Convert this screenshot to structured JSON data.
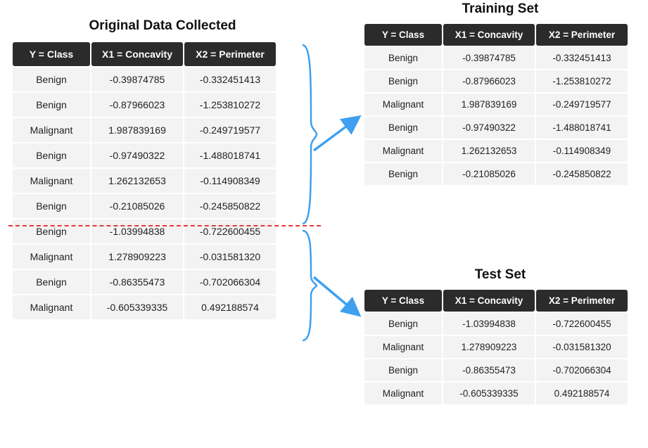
{
  "titles": {
    "original": "Original Data Collected",
    "training": "Training Set",
    "test": "Test Set"
  },
  "columns": {
    "y": "Y = Class",
    "x1": "X1 = Concavity",
    "x2": "X2 = Perimeter"
  },
  "original_rows": [
    {
      "y": "Benign",
      "x1": "-0.39874785",
      "x2": "-0.332451413"
    },
    {
      "y": "Benign",
      "x1": "-0.87966023",
      "x2": "-1.253810272"
    },
    {
      "y": "Malignant",
      "x1": "1.987839169",
      "x2": "-0.249719577"
    },
    {
      "y": "Benign",
      "x1": "-0.97490322",
      "x2": "-1.488018741"
    },
    {
      "y": "Malignant",
      "x1": "1.262132653",
      "x2": "-0.114908349"
    },
    {
      "y": "Benign",
      "x1": "-0.21085026",
      "x2": "-0.245850822"
    },
    {
      "y": "Benign",
      "x1": "-1.03994838",
      "x2": "-0.722600455"
    },
    {
      "y": "Malignant",
      "x1": "1.278909223",
      "x2": "-0.031581320"
    },
    {
      "y": "Benign",
      "x1": "-0.86355473",
      "x2": "-0.702066304"
    },
    {
      "y": "Malignant",
      "x1": "-0.605339335",
      "x2": "0.492188574"
    }
  ],
  "training_rows": [
    {
      "y": "Benign",
      "x1": "-0.39874785",
      "x2": "-0.332451413"
    },
    {
      "y": "Benign",
      "x1": "-0.87966023",
      "x2": "-1.253810272"
    },
    {
      "y": "Malignant",
      "x1": "1.987839169",
      "x2": "-0.249719577"
    },
    {
      "y": "Benign",
      "x1": "-0.97490322",
      "x2": "-1.488018741"
    },
    {
      "y": "Malignant",
      "x1": "1.262132653",
      "x2": "-0.114908349"
    },
    {
      "y": "Benign",
      "x1": "-0.21085026",
      "x2": "-0.245850822"
    }
  ],
  "test_rows": [
    {
      "y": "Benign",
      "x1": "-1.03994838",
      "x2": "-0.722600455"
    },
    {
      "y": "Malignant",
      "x1": "1.278909223",
      "x2": "-0.031581320"
    },
    {
      "y": "Benign",
      "x1": "-0.86355473",
      "x2": "-0.702066304"
    },
    {
      "y": "Malignant",
      "x1": "-0.605339335",
      "x2": "0.492188574"
    }
  ],
  "colors": {
    "arrow": "#3fa0ef",
    "split": "#e53935",
    "header_bg": "#2b2b2b",
    "cell_bg": "#f3f3f3"
  }
}
